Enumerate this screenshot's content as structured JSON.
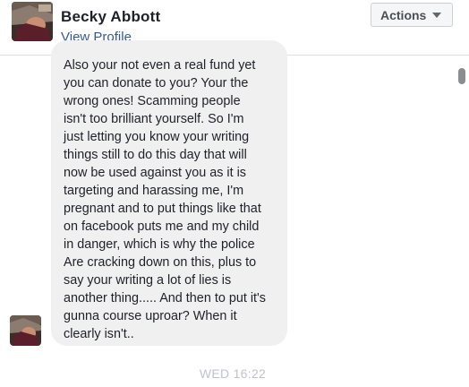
{
  "header": {
    "name": "Becky Abbott",
    "view_profile_label": "View Profile",
    "actions_label": "Actions",
    "actions_icon": "caret-down-icon"
  },
  "message": {
    "lines": [
      "Also your not even a real fund yet",
      "you can donate to you? Your the",
      "wrong ones! Scamming people",
      "isn't too brilliant yourself. So I'm",
      "just letting you know your writing",
      "things still to do this day that will",
      "now be used against you as it is",
      "targeting and harassing me, I'm",
      "pregnant and to put things like that",
      "on facebook puts me and my child",
      "in danger, which is why the police",
      "Are cracking down on this, plus to",
      "say your writing a lot of lies is",
      "another thing..... And then to put it's",
      "gunna course uproar? When it",
      "clearly isn't.."
    ]
  },
  "timestamp": "WED 16:22",
  "colors": {
    "link": "#365899",
    "bubble": "#f1f0f0",
    "text": "#1d2129",
    "timestamp": "#bec3c9"
  }
}
